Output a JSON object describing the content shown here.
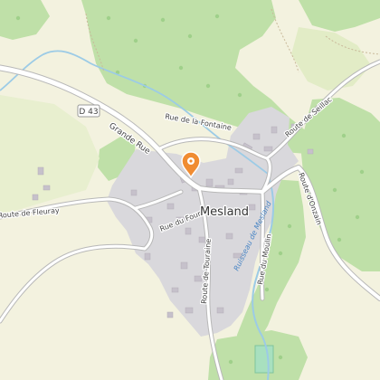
{
  "map": {
    "place_name": "Mesland",
    "marker": {
      "icon": "location-pin-icon",
      "color": "#f08c32"
    },
    "roads": [
      {
        "id": "d43",
        "label": "D 43"
      },
      {
        "id": "grande-rue",
        "label": "Grande Rue"
      },
      {
        "id": "rue-fontaine",
        "label": "Rue de la Fontaine"
      },
      {
        "id": "route-seillac",
        "label": "Route de Seillac"
      },
      {
        "id": "route-onzain",
        "label": "Route d'Onzain"
      },
      {
        "id": "rue-four",
        "label": "Rue du Four"
      },
      {
        "id": "route-fleuray",
        "label": "Route de Fleuray"
      },
      {
        "id": "route-touraine",
        "label": "Route de Touraine"
      },
      {
        "id": "rue-moulin",
        "label": "Rue du Moulin"
      }
    ],
    "water": [
      {
        "id": "ruisseau-mesland",
        "label": "Ruisseau de Mesland"
      }
    ],
    "colors": {
      "field": "#f3f2df",
      "forest": "#bfe0a8",
      "meadow": "#e2ecc6",
      "village": "#d9d8dc",
      "water": "#9ccbe6",
      "road": "#ffffff",
      "road_casing": "#b8b8b8"
    }
  }
}
